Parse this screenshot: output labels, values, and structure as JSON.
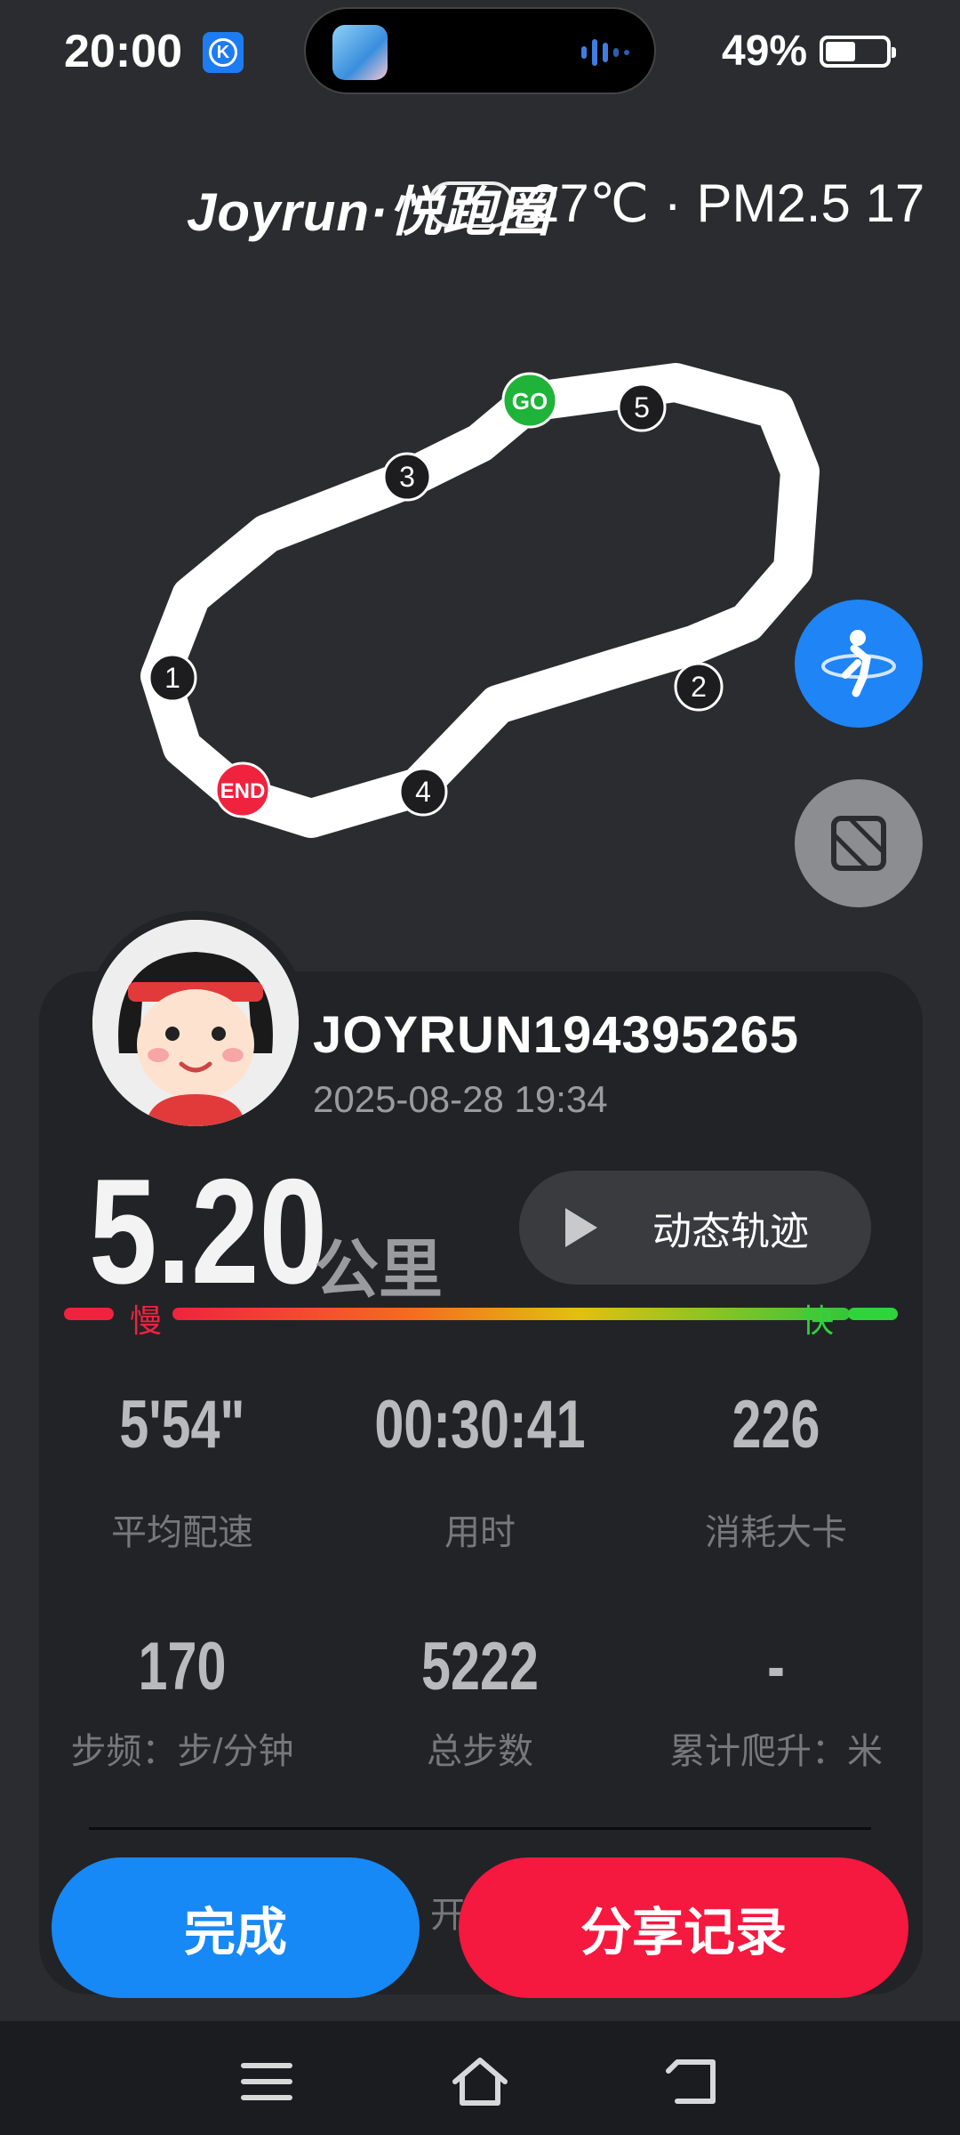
{
  "status_bar": {
    "time": "20:00",
    "notification_icon": "k-app-icon",
    "battery_percent": "49%",
    "battery_level": 0.49
  },
  "header": {
    "brand": "Joyrun·悦跑圈",
    "weather_icon": "cloud-icon",
    "weather": "27℃ · PM2.5 17"
  },
  "map": {
    "markers": [
      "GO",
      "1",
      "2",
      "3",
      "4",
      "5",
      "END"
    ],
    "run_button_icon": "runner-icon",
    "layer_button_icon": "map-layer-icon"
  },
  "profile": {
    "username": "JOYRUN194395265",
    "datetime": "2025-08-28 19:34"
  },
  "summary": {
    "distance": "5.20",
    "distance_unit": "公里",
    "replay_label": "动态轨迹",
    "slow_label": "慢",
    "fast_label": "快"
  },
  "stats": [
    {
      "value": "5'54\"",
      "label": "平均配速"
    },
    {
      "value": "00:30:41",
      "label": "用时"
    },
    {
      "value": "226",
      "label": "消耗大卡"
    },
    {
      "value": "170",
      "label": "步频：步/分钟"
    },
    {
      "value": "5222",
      "label": "总步数"
    },
    {
      "value": "-",
      "label": "累计爬升：米"
    }
  ],
  "partial_text": "开",
  "actions": {
    "done_label": "完成",
    "share_label": "分享记录"
  },
  "nav": [
    "menu-icon",
    "home-icon",
    "back-icon"
  ],
  "colors": {
    "accent_blue": "#1789f6",
    "accent_red": "#f5183f",
    "go_green": "#1fb33a",
    "end_red": "#f0233f"
  }
}
